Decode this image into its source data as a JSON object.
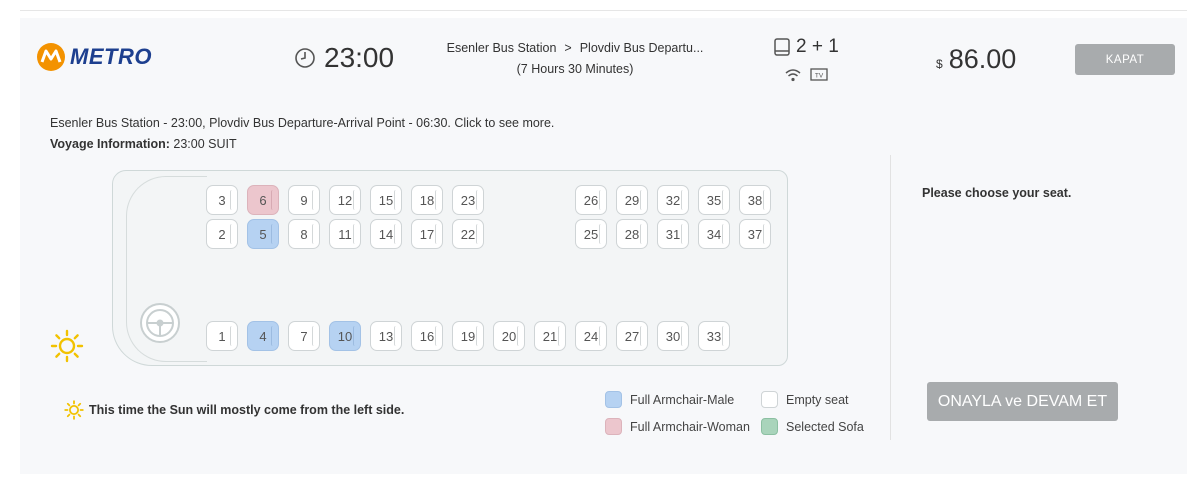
{
  "brand": {
    "name": "METRO",
    "accent": "#f39200",
    "color": "#1d3f8f"
  },
  "trip": {
    "time": "23:00",
    "from": "Esenler Bus Station",
    "separator": ">",
    "to": "Plovdiv Bus Departu...",
    "duration": "(7 Hours 30 Minutes)",
    "layout": "2 + 1",
    "amenities": [
      "wifi-icon",
      "tv-icon"
    ],
    "tv_label": "TV",
    "currency": "$",
    "price": "86.00",
    "close_label": "KAPAT"
  },
  "description": {
    "summary": "Esenler Bus Station - 23:00, Plovdiv Bus Departure-Arrival Point - 06:30. Click to see more.",
    "voyage_label": "Voyage Information:",
    "voyage_value": "23:00 SUIT"
  },
  "prompt": "Please choose your seat.",
  "seats": {
    "top_row": [
      {
        "n": "3",
        "s": "empty"
      },
      {
        "n": "6",
        "s": "female"
      },
      {
        "n": "9",
        "s": "empty"
      },
      {
        "n": "12",
        "s": "empty"
      },
      {
        "n": "15",
        "s": "empty"
      },
      {
        "n": "18",
        "s": "empty"
      },
      {
        "n": "23",
        "s": "empty"
      },
      {
        "n": "26",
        "s": "empty"
      },
      {
        "n": "29",
        "s": "empty"
      },
      {
        "n": "32",
        "s": "empty"
      },
      {
        "n": "35",
        "s": "empty"
      },
      {
        "n": "38",
        "s": "empty"
      }
    ],
    "second_row": [
      {
        "n": "2",
        "s": "empty"
      },
      {
        "n": "5",
        "s": "male"
      },
      {
        "n": "8",
        "s": "empty"
      },
      {
        "n": "11",
        "s": "empty"
      },
      {
        "n": "14",
        "s": "empty"
      },
      {
        "n": "17",
        "s": "empty"
      },
      {
        "n": "22",
        "s": "empty"
      },
      {
        "n": "25",
        "s": "empty"
      },
      {
        "n": "28",
        "s": "empty"
      },
      {
        "n": "31",
        "s": "empty"
      },
      {
        "n": "34",
        "s": "empty"
      },
      {
        "n": "37",
        "s": "empty"
      }
    ],
    "bottom_row": [
      {
        "n": "1",
        "s": "empty"
      },
      {
        "n": "4",
        "s": "male"
      },
      {
        "n": "7",
        "s": "empty"
      },
      {
        "n": "10",
        "s": "male"
      },
      {
        "n": "13",
        "s": "empty"
      },
      {
        "n": "16",
        "s": "empty"
      },
      {
        "n": "19",
        "s": "empty"
      },
      {
        "n": "20",
        "s": "empty"
      },
      {
        "n": "21",
        "s": "empty"
      },
      {
        "n": "24",
        "s": "empty"
      },
      {
        "n": "27",
        "s": "empty"
      },
      {
        "n": "30",
        "s": "empty"
      },
      {
        "n": "33",
        "s": "empty"
      }
    ]
  },
  "sun_note": "This time the Sun will mostly come from the left side.",
  "legend": {
    "male": "Full Armchair-Male",
    "female": "Full Armchair-Woman",
    "empty": "Empty seat",
    "sofa": "Selected Sofa"
  },
  "colors": {
    "male": "#b6d2f2",
    "female": "#ecc6cd",
    "sofa": "#a9d4bb",
    "button": "#a8abad",
    "sun": "#f2c200"
  },
  "confirm_label": "ONAYLA ve DEVAM ET"
}
